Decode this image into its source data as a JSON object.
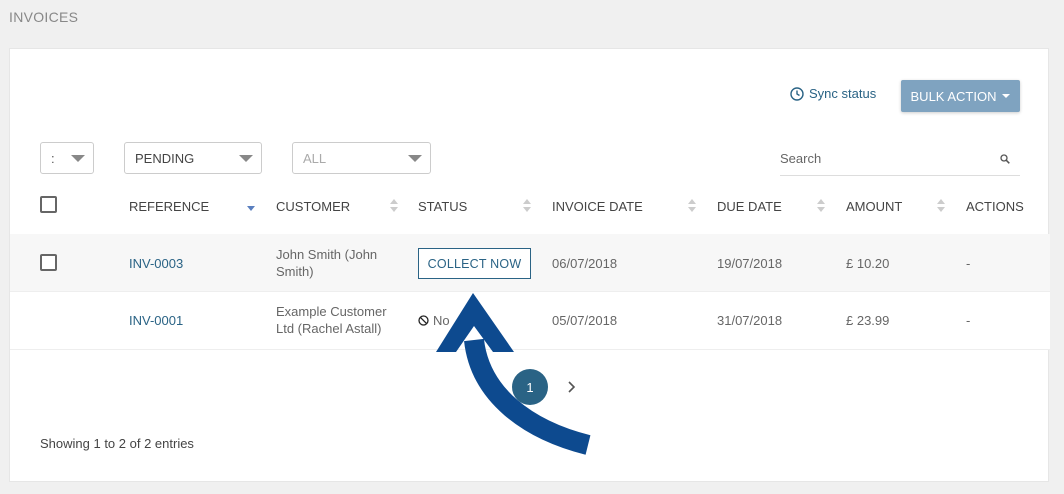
{
  "page": {
    "title": "INVOICES"
  },
  "toolbar": {
    "sync_label": "Sync status",
    "bulk_label": "BULK ACTION"
  },
  "filters": {
    "page_size_value": ":",
    "status_value": "PENDING",
    "type_value": "ALL",
    "search_placeholder": "Search"
  },
  "table": {
    "headers": {
      "reference": "REFERENCE",
      "customer": "CUSTOMER",
      "status": "STATUS",
      "invoice_date": "INVOICE DATE",
      "due_date": "DUE DATE",
      "amount": "AMOUNT",
      "actions": "ACTIONS"
    },
    "rows": [
      {
        "reference": "INV-0003",
        "customer_line1": "John Smith (John",
        "customer_line2": "Smith)",
        "status": "COLLECT NOW",
        "invoice_date": "06/07/2018",
        "due_date": "19/07/2018",
        "amount": "£ 10.20",
        "actions": "-"
      },
      {
        "reference": "INV-0001",
        "customer_line1": "Example Customer",
        "customer_line2": "Ltd (Rachel Astall)",
        "status": "No",
        "invoice_date": "05/07/2018",
        "due_date": "31/07/2018",
        "amount": "£ 23.99",
        "actions": "-"
      }
    ]
  },
  "pagination": {
    "current_page": "1"
  },
  "footer": {
    "entries_text": "Showing 1 to 2 of 2 entries"
  },
  "colors": {
    "accent": "#2a6385",
    "arrow": "#0d4a8f",
    "bulk_button": "#7fa3c0"
  }
}
